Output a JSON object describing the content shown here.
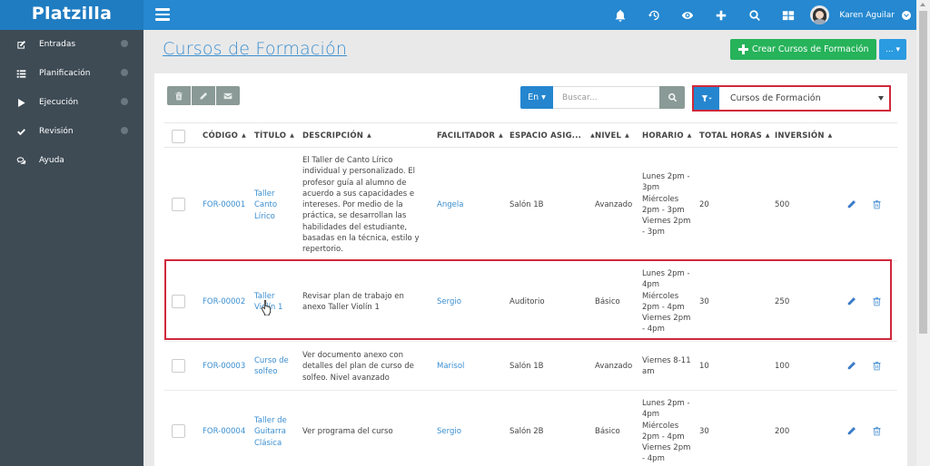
{
  "app": {
    "brand": "Platzilla",
    "user_name": "Karen Aguilar"
  },
  "topbar": {
    "icons": [
      "bell-icon",
      "history-icon",
      "eye-icon",
      "plus-icon",
      "search-icon",
      "grid-icon"
    ]
  },
  "sidebar": {
    "items": [
      {
        "label": "Entradas",
        "icon": "edit-icon",
        "has_submenu": true
      },
      {
        "label": "Planificación",
        "icon": "list-icon",
        "has_submenu": true
      },
      {
        "label": "Ejecución",
        "icon": "play-icon",
        "has_submenu": true
      },
      {
        "label": "Revisión",
        "icon": "check-icon",
        "has_submenu": true
      },
      {
        "label": "Ayuda",
        "icon": "chat-icon",
        "has_submenu": false
      }
    ]
  },
  "page": {
    "title": "Cursos de Formación",
    "create_button": "Crear Cursos de Formación",
    "more_button": "... ▾"
  },
  "toolbar": {
    "en_label": "En ▾",
    "search_placeholder": "Buscar...",
    "search_value": "",
    "filter_value": "Cursos de Formación"
  },
  "colors": {
    "primary": "#2588d0",
    "sidebar": "#3e4b55",
    "success": "#26b35a",
    "highlight": "#d0283a",
    "link": "#3a8ed0"
  },
  "table": {
    "columns": [
      "CÓDIGO",
      "TÍTULO",
      "DESCRIPCIÓN",
      "FACILITADOR",
      "ESPACIO ASIG...",
      "NIVEL",
      "HORARIO",
      "TOTAL HORAS",
      "INVERSIÓN"
    ],
    "rows": [
      {
        "codigo": "FOR-00001",
        "titulo": "Taller Canto Lírico",
        "descripcion": "El Taller de Canto Lírico individual y personalizado. El profesor guía al alumno de acuerdo a sus capacidades e intereses. Por medio de la práctica, se desarrollan las habilidades del estudiante, basadas en la técnica, estilo y repertorio.",
        "facilitador": "Angela",
        "espacio": "Salón 1B",
        "nivel": "Avanzado",
        "horario": "Lunes 2pm - 3pm Miércoles 2pm - 3pm Viernes 2pm - 3pm",
        "total_horas": "20",
        "inversion": "500"
      },
      {
        "codigo": "FOR-00002",
        "titulo": "Taller Violín 1",
        "descripcion": "Revisar plan de trabajo en anexo Taller Violín 1",
        "facilitador": "Sergio",
        "espacio": "Auditorio",
        "nivel": "Básico",
        "horario": "Lunes 2pm - 4pm Miércoles 2pm - 4pm Viernes 2pm - 4pm",
        "total_horas": "30",
        "inversion": "250"
      },
      {
        "codigo": "FOR-00003",
        "titulo": "Curso de solfeo",
        "descripcion": "Ver documento anexo con detalles del plan de curso de solfeo. Nivel avanzado",
        "facilitador": "Marisol",
        "espacio": "Salón 1B",
        "nivel": "Avanzado",
        "horario": "Viernes 8-11 am",
        "total_horas": "10",
        "inversion": "100"
      },
      {
        "codigo": "FOR-00004",
        "titulo": "Taller de Guitarra Clásica",
        "descripcion": "Ver programa del curso",
        "facilitador": "Sergio",
        "espacio": "Salón 2B",
        "nivel": "Básico",
        "horario": "Lunes 2pm - 4pm Miércoles 2pm - 4pm Viernes 2pm - 4pm",
        "total_horas": "30",
        "inversion": "200"
      }
    ]
  }
}
